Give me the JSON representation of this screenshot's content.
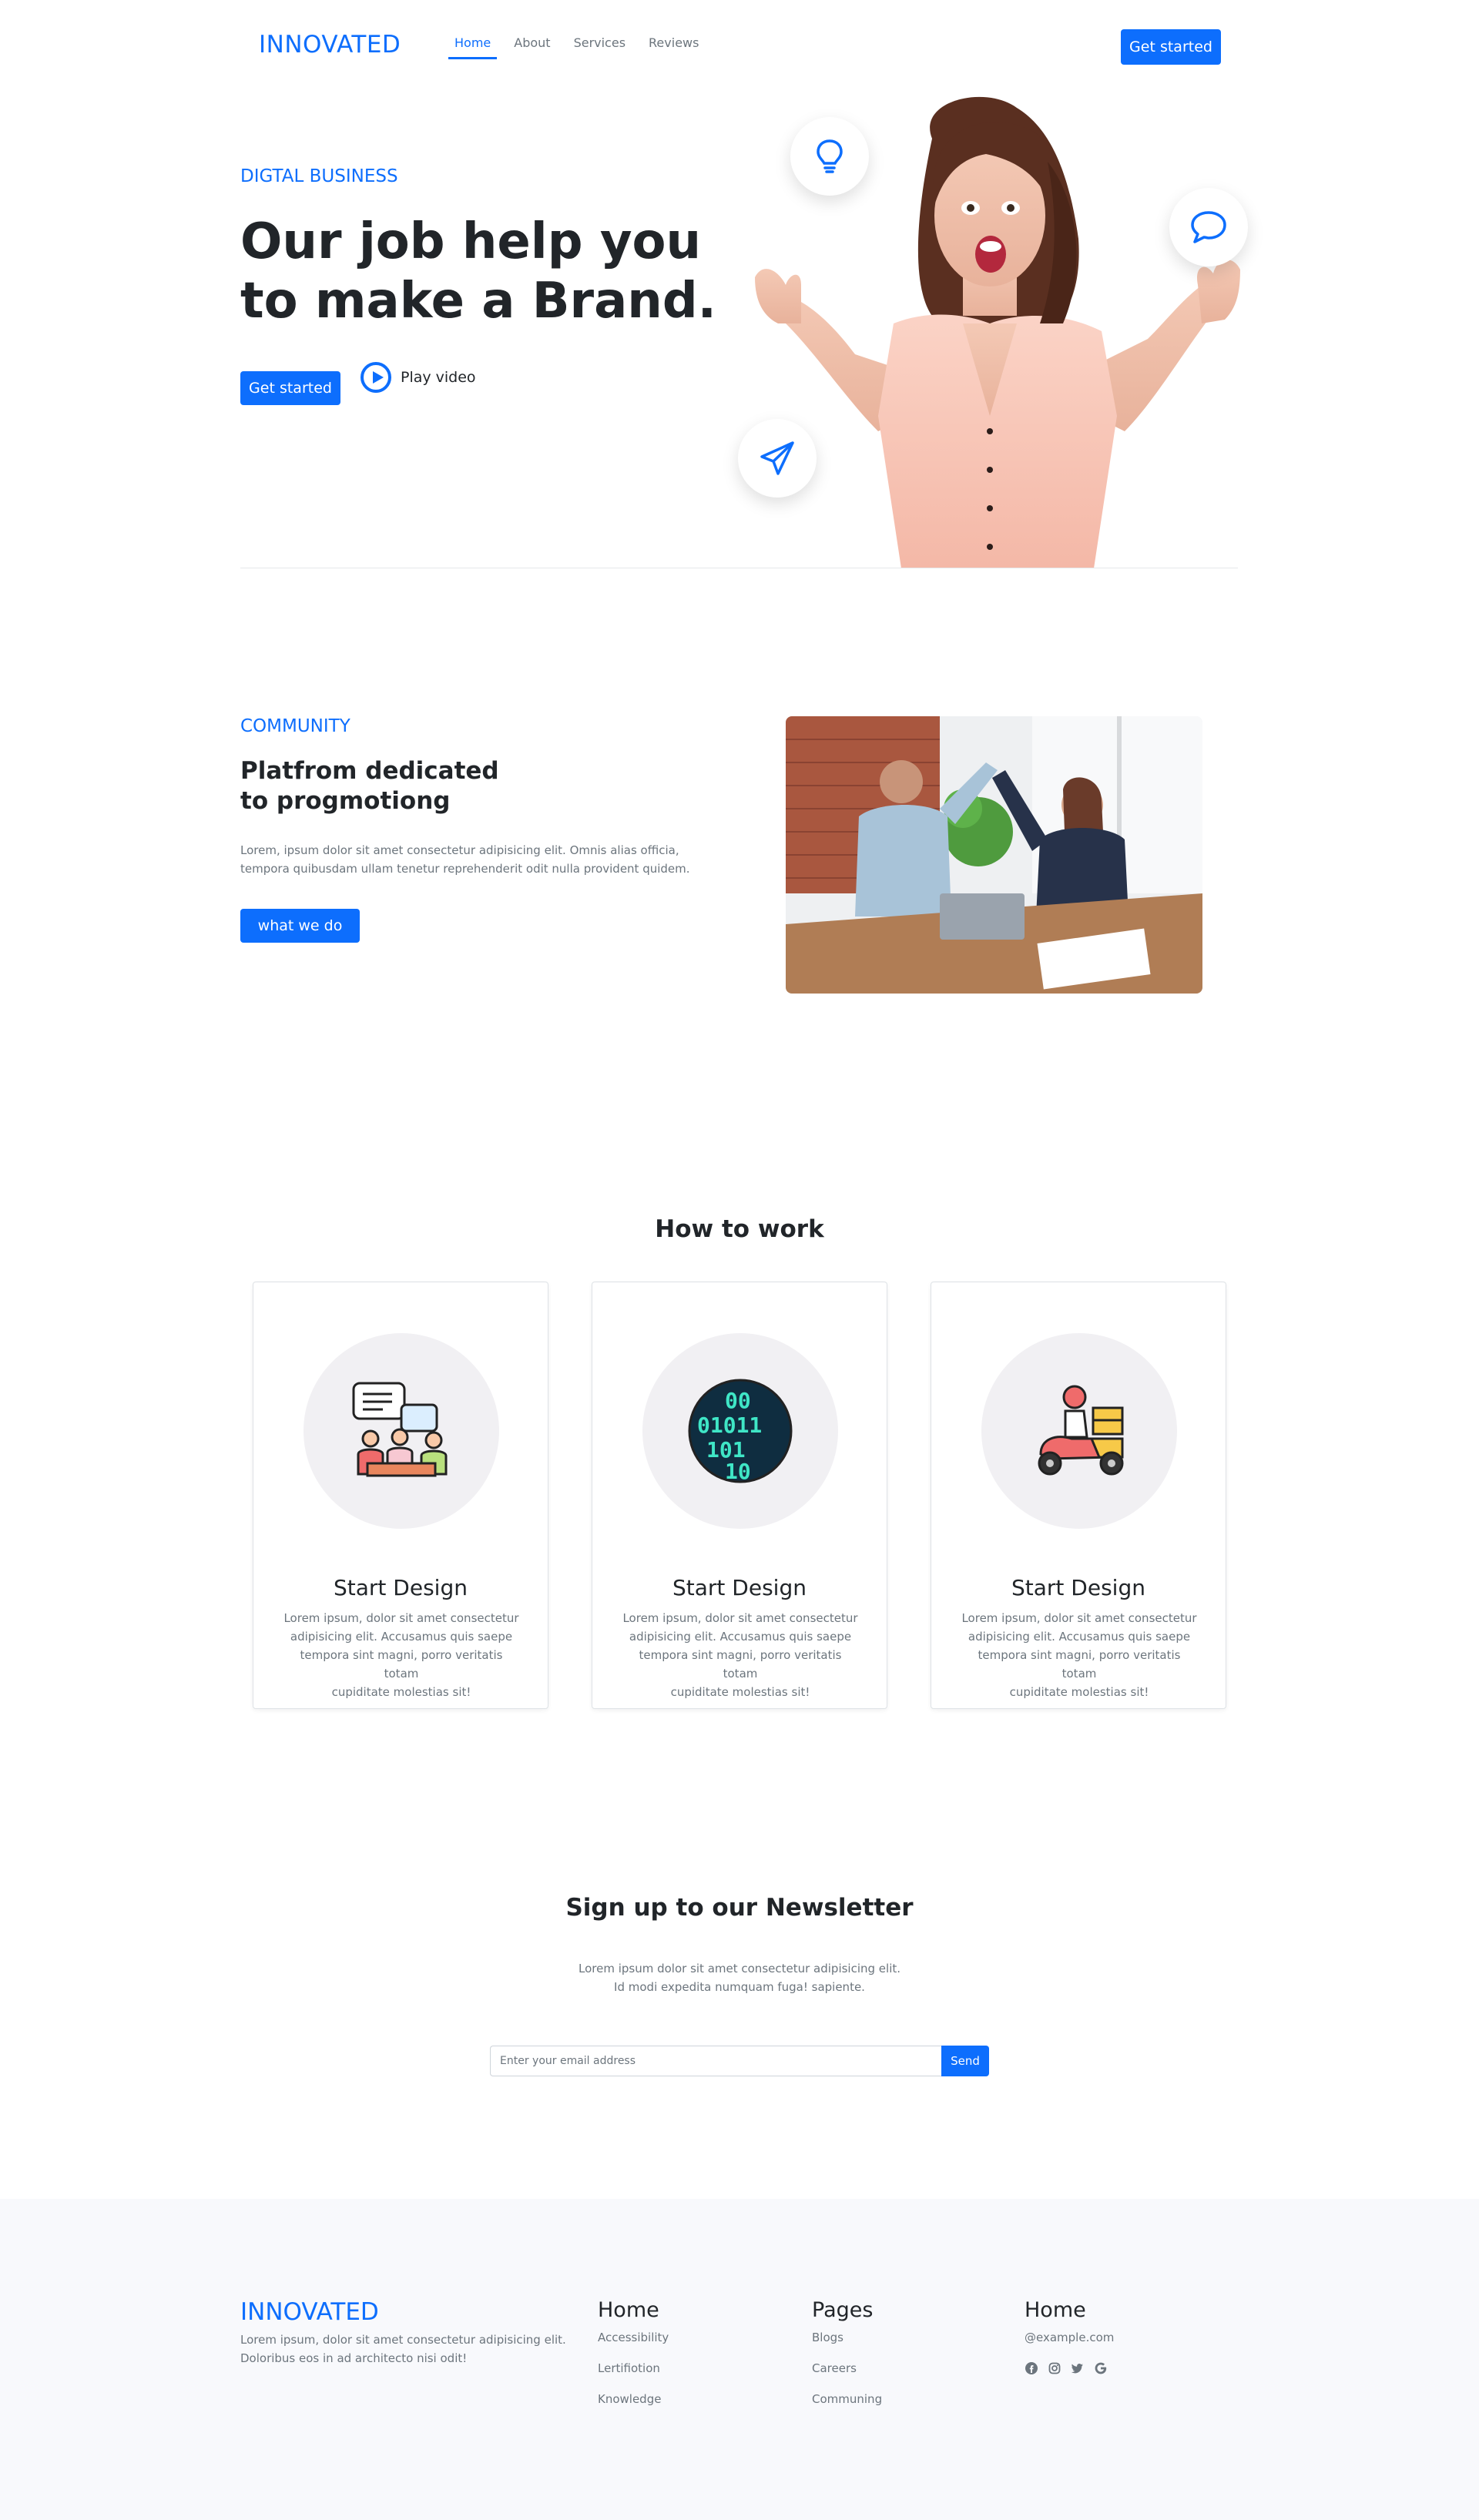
{
  "navbar": {
    "brand": "INNOVATED",
    "links": [
      "Home",
      "About",
      "Services",
      "Reviews"
    ],
    "active": "Home",
    "cta": "Get started"
  },
  "hero": {
    "eyebrow": "DIGTAL BUSINESS",
    "title_line1": "Our job help you",
    "title_line2": "to make a Brand.",
    "cta": "Get started",
    "play_label": "Play video",
    "float_icons": [
      "lightbulb-icon",
      "chat-icon",
      "paper-plane-icon"
    ]
  },
  "community": {
    "eyebrow": "COMMUNITY",
    "title_line1": "Platfrom dedicated",
    "title_line2": "to progmotiong",
    "text_line1": "Lorem, ipsum dolor sit amet consectetur adipisicing elit. Omnis alias officia,",
    "text_line2": "tempora quibusdam ullam tenetur reprehenderit odit nulla provident quidem.",
    "button": "what we do"
  },
  "how": {
    "title": "How to work",
    "cards": [
      {
        "icon": "team-meeting-icon",
        "title": "Start Design",
        "text_line1": "Lorem ipsum, dolor sit amet consectetur",
        "text_line2": "adipisicing elit. Accusamus quis saepe",
        "text_line3": "tempora sint magni, porro veritatis totam",
        "text_line4": "cupiditate molestias sit!"
      },
      {
        "icon": "binary-code-icon",
        "title": "Start Design",
        "text_line1": "Lorem ipsum, dolor sit amet consectetur",
        "text_line2": "adipisicing elit. Accusamus quis saepe",
        "text_line3": "tempora sint magni, porro veritatis totam",
        "text_line4": "cupiditate molestias sit!"
      },
      {
        "icon": "delivery-scooter-icon",
        "title": "Start Design",
        "text_line1": "Lorem ipsum, dolor sit amet consectetur",
        "text_line2": "adipisicing elit. Accusamus quis saepe",
        "text_line3": "tempora sint magni, porro veritatis totam",
        "text_line4": "cupiditate molestias sit!"
      }
    ]
  },
  "newsletter": {
    "title": "Sign up to our Newsletter",
    "text_line1": "Lorem ipsum dolor sit amet consectetur adipisicing elit.",
    "text_line2": "Id modi expedita numquam fuga! sapiente.",
    "placeholder": "Enter your email address",
    "button": "Send"
  },
  "footer": {
    "brand": "INNOVATED",
    "text_line1": "Lorem ipsum, dolor sit amet consectetur adipisicing elit.",
    "text_line2": "Doloribus eos in ad architecto nisi odit!",
    "col1": {
      "title": "Home",
      "links": [
        "Accessibility",
        "Lertifiotion",
        "Knowledge"
      ]
    },
    "col2": {
      "title": "Pages",
      "links": [
        "Blogs",
        "Careers",
        "Communing"
      ]
    },
    "col3": {
      "title": "Home",
      "email": "@example.com",
      "social": [
        "facebook-icon",
        "instagram-icon",
        "twitter-icon",
        "google-icon"
      ]
    }
  },
  "colors": {
    "primary": "#0d6efd",
    "text": "#212529",
    "muted": "#6c757d",
    "footer_bg": "#f8f9fc",
    "card_circle": "#f1f0f3"
  }
}
